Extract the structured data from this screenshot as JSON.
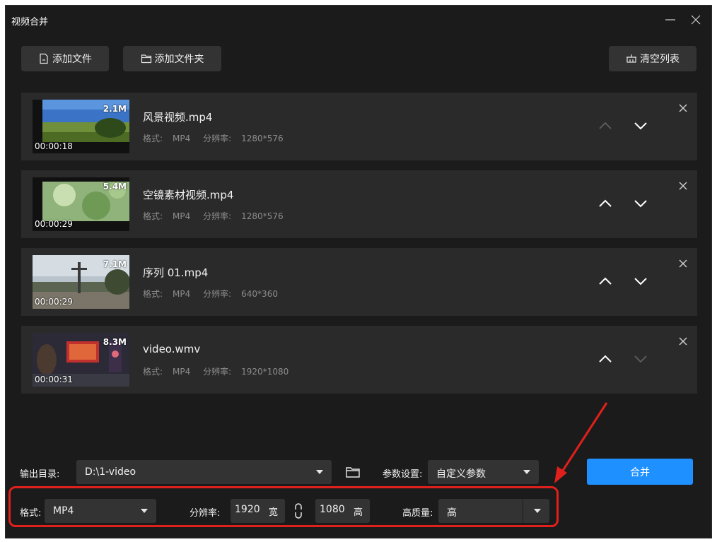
{
  "window": {
    "title": "视频合并"
  },
  "toolbar": {
    "add_file": "添加文件",
    "add_folder": "添加文件夹",
    "clear_list": "清空列表"
  },
  "meta_labels": {
    "format": "格式:",
    "resolution": "分辨率:"
  },
  "files": [
    {
      "name": "风景视频.mp4",
      "format": "MP4",
      "resolution": "1280*576",
      "size": "2.1M",
      "duration": "00:00:18",
      "up_enabled": false,
      "down_enabled": true
    },
    {
      "name": "空镜素材视频.mp4",
      "format": "MP4",
      "resolution": "1280*576",
      "size": "5.4M",
      "duration": "00:00:29",
      "up_enabled": true,
      "down_enabled": true
    },
    {
      "name": "序列 01.mp4",
      "format": "MP4",
      "resolution": "640*360",
      "size": "7.1M",
      "duration": "00:00:29",
      "up_enabled": true,
      "down_enabled": true
    },
    {
      "name": "video.wmv",
      "format": "MP4",
      "resolution": "1920*1080",
      "size": "8.3M",
      "duration": "00:00:31",
      "up_enabled": true,
      "down_enabled": false
    }
  ],
  "output": {
    "dir_label": "输出目录:",
    "dir_value": "D:\\1-video",
    "params_label": "参数设置:",
    "params_value": "自定义参数",
    "merge_label": "合并"
  },
  "settings": {
    "format_label": "格式:",
    "format_value": "MP4",
    "resolution_label": "分辨率:",
    "width_value": "1920",
    "width_unit": "宽",
    "height_value": "1080",
    "height_unit": "高",
    "quality_label": "高质量:",
    "quality_value": "高"
  },
  "colors": {
    "accent": "#1e90ff",
    "highlight": "#e0201c",
    "panel": "#2a2a2a",
    "background": "#1b1b1b"
  }
}
